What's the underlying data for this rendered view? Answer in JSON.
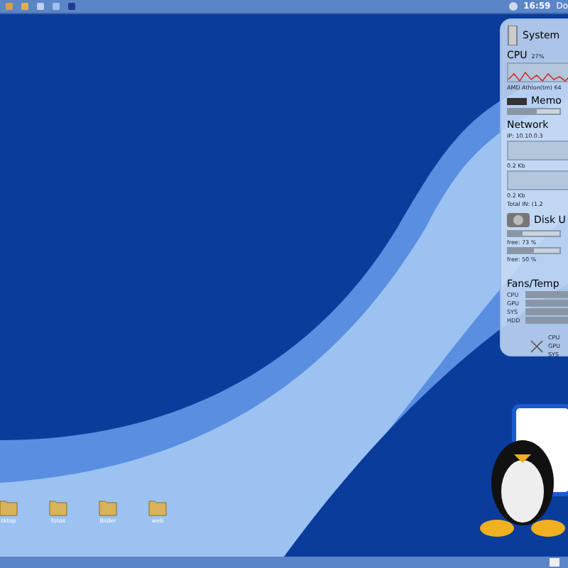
{
  "top_panel": {
    "clock": "16:59",
    "date": "Do"
  },
  "monitor": {
    "system": {
      "title": "System"
    },
    "cpu": {
      "title": "CPU",
      "reading": "27%",
      "model": "AMD Athlon(tm) 64"
    },
    "memory": {
      "title": "Memo",
      "level": 0.55
    },
    "network": {
      "title": "Network",
      "ip": "IP: 10.10.0.3",
      "rates": [
        "0.2 Kb",
        "0.2 Kb"
      ],
      "total": "Total IN: (1.2"
    },
    "disk": {
      "title": "Disk U",
      "drives": [
        {
          "free": "free: 73 %",
          "level": 0.27
        },
        {
          "free": "free: 50 %",
          "level": 0.5
        }
      ]
    },
    "fans": {
      "title": "Fans/Temp",
      "sensors": [
        {
          "label": "CPU",
          "level": 0.85
        },
        {
          "label": "GPU",
          "level": 0.85
        },
        {
          "label": "SYS",
          "level": 0.85
        },
        {
          "label": "HDD",
          "level": 0.85
        }
      ],
      "fan_labels": [
        "CPU",
        "GPU",
        "SYS"
      ]
    }
  },
  "desktop_icons": [
    {
      "label": "sktop"
    },
    {
      "label": "fotos"
    },
    {
      "label": "Bilder"
    },
    {
      "label": "web"
    }
  ]
}
